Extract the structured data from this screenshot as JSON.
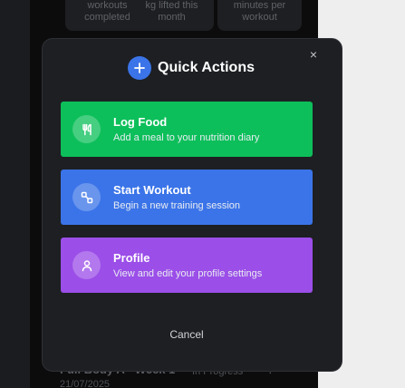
{
  "background": {
    "stats": [
      {
        "line1": "workouts",
        "line2": "completed"
      },
      {
        "line1": "kg lifted this",
        "line2": "month"
      },
      {
        "line1": "minutes per",
        "line2": "workout"
      }
    ],
    "recent": {
      "title": "Full Body A - Week 1",
      "status": "In Progress",
      "more_icon": "ellipsis-icon",
      "date": "21/07/2025"
    }
  },
  "modal": {
    "title": "Quick Actions",
    "title_icon": "plus-icon",
    "close_label": "×",
    "actions": [
      {
        "title": "Log Food",
        "subtitle": "Add a meal to your nutrition diary",
        "icon": "utensils-icon",
        "color": "#0dbf5a"
      },
      {
        "title": "Start Workout",
        "subtitle": "Begin a new training session",
        "icon": "dumbbell-icon",
        "color": "#3b74e8"
      },
      {
        "title": "Profile",
        "subtitle": "View and edit your profile settings",
        "icon": "user-icon",
        "color": "#9b4ee8"
      }
    ],
    "cancel_label": "Cancel"
  },
  "colors": {
    "accent": "#3b74e8",
    "modal_bg": "#1d1f23",
    "page_bg": "#0c0c0d"
  }
}
